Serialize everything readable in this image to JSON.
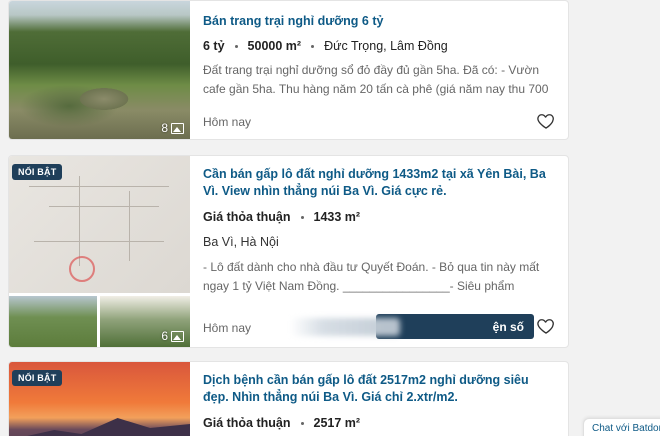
{
  "listings": [
    {
      "title": "Bán trang trại nghỉ dưỡng 6 tỷ",
      "price": "6 tỷ",
      "area": "50000 m²",
      "location": "Đức Trọng, Lâm Đồng",
      "description": "Đất trang trại nghỉ dưỡng sổ đỏ đầy đủ gần 5ha. Đã có: - Vườn cafe gần 5ha. Thu hàng năm 20 tấn cà phê (giá năm nay thu 700 triệu, cá...",
      "image_count": "8",
      "posted": "Hôm nay"
    },
    {
      "badge": "NỔI BẬT",
      "title": "Cần bán gấp lô đất nghỉ dưỡng 1433m2 tại xã Yên Bài, Ba Vì. View nhìn thẳng núi Ba Vì. Giá cực rẻ.",
      "price": "Giá thỏa thuận",
      "area": "1433 m²",
      "location": "Ba Vì, Hà Nội",
      "description": "- Lô đất dành cho nhà đầu tư Quyết Đoán. - Bỏ qua tin này mất ngay 1 tỷ Việt Nam Đồng. ________________- Siêu phẩm 1433m2 view nhìn trực tiếp núi Ba Vì. - Vị trí lô đất nằm trong quần thể biệt thự ng...",
      "image_count": "6",
      "posted": "Hôm nay",
      "phone_button": "ện số"
    },
    {
      "badge": "NỔI BẬT",
      "title": "Dịch bệnh cần bán gấp lô đất 2517m2 nghỉ dưỡng siêu đẹp. Nhìn thẳng núi Ba Vì. Giá chỉ 2.xtr/m2.",
      "price": "Giá thỏa thuận",
      "area": "2517 m²"
    }
  ],
  "chat_widget": {
    "label": "Chat với Batdongsan"
  },
  "colors": {
    "title": "#0e5a86",
    "badge_bg": "#1f3f5a",
    "button_bg": "#1f3f5a"
  }
}
